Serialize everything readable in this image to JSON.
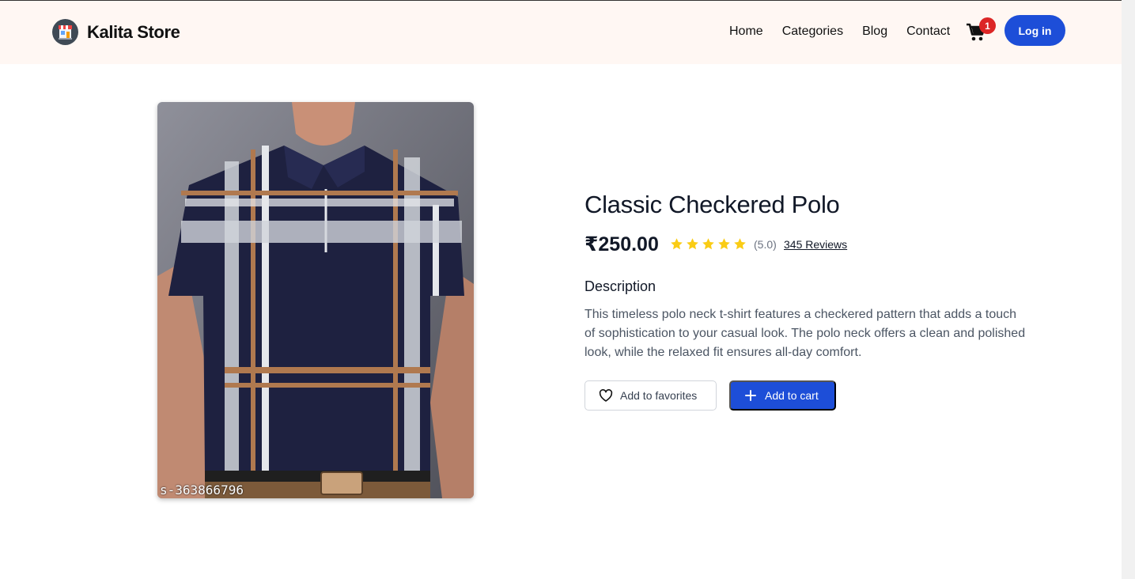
{
  "header": {
    "brand_name": "Kalita Store",
    "nav": [
      "Home",
      "Categories",
      "Blog",
      "Contact"
    ],
    "cart_count": "1",
    "login_label": "Log in"
  },
  "product": {
    "image_caption": "s-363866796",
    "title": "Classic Checkered Polo",
    "price": "₹250.00",
    "rating_stars": 5,
    "rating_text": "(5.0)",
    "reviews_link": "345 Reviews",
    "description_heading": "Description",
    "description": "This timeless polo neck t-shirt features a checkered pattern that adds a touch of sophistication to your casual look. The polo neck offers a clean and polished look, while the relaxed fit ensures all-day comfort.",
    "favorites_label": "Add to favorites",
    "cart_label": "Add to cart"
  },
  "colors": {
    "accent": "#1d4ed8",
    "badge": "#dc2626",
    "star": "#facc15",
    "header_bg": "#fff7f3"
  },
  "icons": [
    "store-icon",
    "cart-icon",
    "star-icon",
    "heart-icon",
    "plus-icon"
  ]
}
